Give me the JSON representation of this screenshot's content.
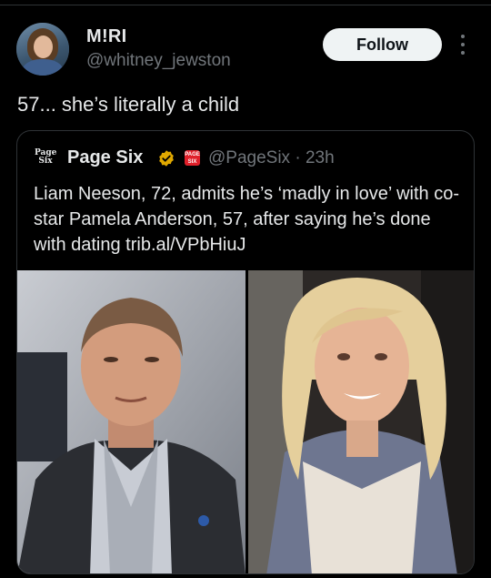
{
  "author": {
    "display_name": "M!RI",
    "handle": "@whitney_jewston",
    "avatar_icon": "user-avatar"
  },
  "follow_label": "Follow",
  "tweet_text": "57... she’s literally a child",
  "quoted": {
    "logo_text": "Page\nSix",
    "name": "Page Six",
    "badge_text": "SIX",
    "handle_time": "@PageSix · 23h",
    "text": "Liam Neeson, 72, admits he’s ‘madly in love’ with co-star Pamela Anderson, 57, after saying he’s done with dating trib.al/VPbHiuJ",
    "verified_color": "#e0a800"
  },
  "colors": {
    "background": "#000000",
    "text": "#e7e9ea",
    "muted": "#71767b",
    "border": "#2f3336"
  }
}
